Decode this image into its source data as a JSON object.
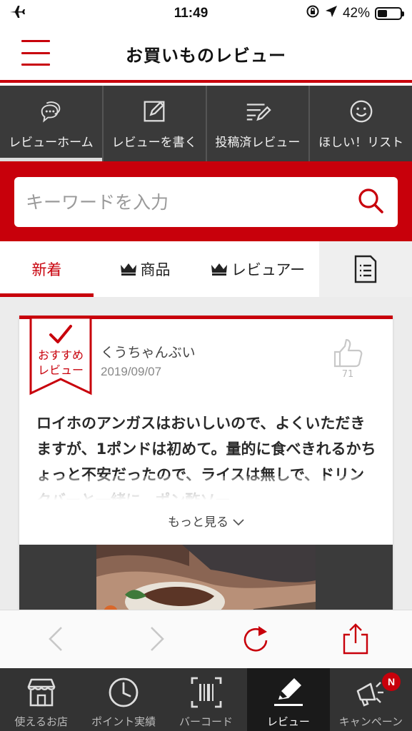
{
  "status_bar": {
    "time": "11:49",
    "battery_text": "42%",
    "battery_level": 0.42,
    "icons": [
      "airplane-icon",
      "orientation-lock-icon",
      "location-arrow-icon",
      "battery-icon"
    ]
  },
  "header": {
    "title": "お買いものレビュー",
    "menu_icon": "hamburger-menu-icon"
  },
  "top_nav": {
    "items": [
      {
        "label": "レビューホーム",
        "icon": "chat-bubbles-icon",
        "active": true
      },
      {
        "label": "レビューを書く",
        "icon": "edit-icon",
        "active": false
      },
      {
        "label": "投稿済レビュー",
        "icon": "posted-list-icon",
        "active": false
      },
      {
        "label": "ほしい！リスト",
        "icon": "smiley-icon",
        "active": false
      }
    ]
  },
  "search": {
    "placeholder": "キーワードを入力",
    "value": "",
    "icon": "search-icon"
  },
  "sort_tabs": {
    "items": [
      {
        "label": "新着",
        "active": true
      },
      {
        "label": "商品",
        "icon": "crown-icon",
        "active": false
      },
      {
        "label": "レビュアー",
        "icon": "crown-icon",
        "active": false
      },
      {
        "icon": "document-list-icon",
        "active": false
      }
    ]
  },
  "review": {
    "ribbon_line1": "おすすめ",
    "ribbon_line2": "レビュー",
    "reviewer": "くうちゃんぶい",
    "date": "2019/09/07",
    "likes": "71",
    "body": "ロイホのアンガスはおいしいので、よくいただきますが、1ポンドは初めて。量的に食べきれるかちょっと不安だったので、ライスは無しで、ドリンクバーと一緒に、ポン酢ソー",
    "more_label": "もっと見る",
    "colors": {
      "accent": "#c8000b"
    }
  },
  "browser_bar": {
    "icons": [
      "back-arrow-icon",
      "forward-arrow-icon",
      "reload-icon",
      "share-icon"
    ]
  },
  "tab_bar": {
    "items": [
      {
        "label": "使えるお店",
        "icon": "store-icon",
        "active": false
      },
      {
        "label": "ポイント実績",
        "icon": "clock-icon",
        "active": false
      },
      {
        "label": "バーコード",
        "icon": "barcode-icon",
        "active": false
      },
      {
        "label": "レビュー",
        "icon": "pencil-icon",
        "active": true
      },
      {
        "label": "キャンペーン",
        "icon": "megaphone-icon",
        "active": false,
        "badge": "N"
      }
    ]
  }
}
